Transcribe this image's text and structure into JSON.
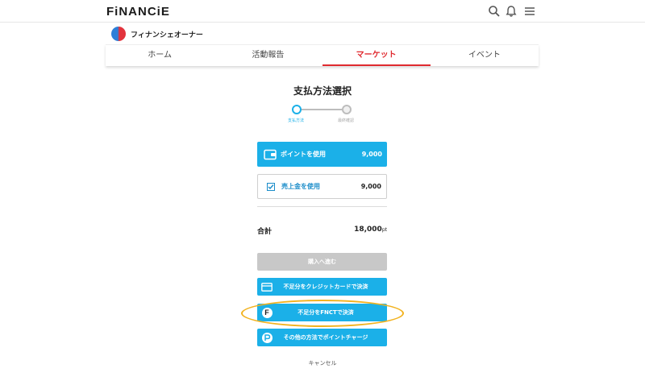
{
  "header": {
    "logo": "FiNANCiE",
    "icons": [
      "search-icon",
      "bell-icon",
      "menu-icon"
    ]
  },
  "community": {
    "name": "フィナンシェオーナー"
  },
  "tabs": [
    {
      "label": "ホーム",
      "active": false
    },
    {
      "label": "活動報告",
      "active": false
    },
    {
      "label": "マーケット",
      "active": true
    },
    {
      "label": "イベント",
      "active": false
    }
  ],
  "page": {
    "title": "支払方法選択"
  },
  "stepper": {
    "steps": [
      "支払方法",
      "最終確認"
    ],
    "current": 1
  },
  "options": {
    "points": {
      "label": "ポイントを使用",
      "value": "9,000"
    },
    "sales": {
      "label": "売上金を使用",
      "value": "9,000",
      "checked": true
    }
  },
  "total": {
    "label": "合計",
    "value": "18,000",
    "unit": "pt"
  },
  "buttons": {
    "proceed": "購入へ進む",
    "credit": "不足分をクレジットカードで決済",
    "fnct": "不足分をFNCTで決済",
    "fnct_icon_letter": "F",
    "other": "その他の方法でポイントチャージ"
  },
  "cancel": "キャンセル",
  "colors": {
    "accent": "#1bb0e8",
    "tab_active": "#e02a2f",
    "disabled": "#c8c8c8",
    "highlight": "#f2b21e"
  }
}
